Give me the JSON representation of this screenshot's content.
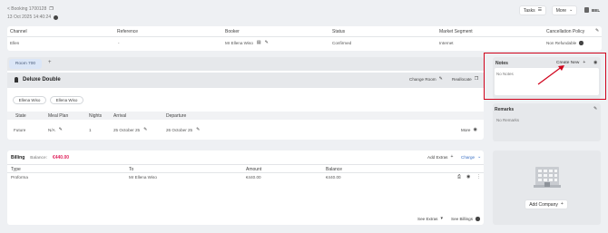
{
  "header": {
    "back_label": "< Booking 1700128",
    "datetime": "13 Oct 2025 14:40:24",
    "tasks_label": "Tasks",
    "more_label": "More",
    "user_initials": "BEL"
  },
  "booking_table": {
    "columns": [
      "Channel",
      "Reference",
      "Booker",
      "Status",
      "Market Segment",
      "Cancellation Policy"
    ],
    "row": [
      "Ellen",
      "-",
      "Mr Ellena Wiso",
      "Confirmed",
      "Internet",
      "Non Refundable"
    ]
  },
  "room_tabs": {
    "active": "Room 700",
    "add": "+"
  },
  "room": {
    "type": "Deluxe Double",
    "change_room": "Change Room",
    "reallocate": "Reallocate",
    "guests": [
      "Ellena Wiso",
      "Ellena Wiso"
    ],
    "columns": [
      "State",
      "Meal Plan",
      "Nights",
      "Arrival",
      "Departure"
    ],
    "row": [
      "Future",
      "N/A",
      "1",
      "25 October 25",
      "26 October 25"
    ],
    "more_label": "More"
  },
  "billing": {
    "title": "Billing",
    "balance_label": "Balance:",
    "balance_value": "€440.00",
    "add_extras": "Add Extras",
    "charge": "Charge",
    "columns": [
      "Type",
      "To",
      "Amount",
      "Balance"
    ],
    "row": [
      "Proforma",
      "Mr Ellena Wiso",
      "€440.00",
      "€440.00"
    ],
    "see_extras": "See Extras",
    "see_billings": "See Billings"
  },
  "notes": {
    "title": "Notes",
    "create_new": "Create New",
    "empty": "No Notes"
  },
  "remarks": {
    "title": "Remarks",
    "empty": "No Remarks"
  },
  "company": {
    "add_label": "Add Company"
  },
  "colors": {
    "accent": "#d0021b",
    "highlight_border": "#d0021b",
    "balance": "#e0245e"
  }
}
